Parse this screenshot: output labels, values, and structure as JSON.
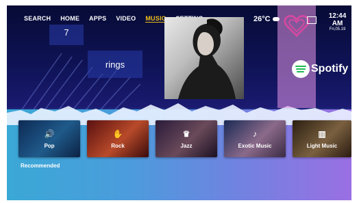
{
  "nav": {
    "items": [
      {
        "label": "SEARCH",
        "active": false
      },
      {
        "label": "HOME",
        "active": false
      },
      {
        "label": "APPS",
        "active": false
      },
      {
        "label": "VIDEO",
        "active": false
      },
      {
        "label": "MUSIC",
        "active": true
      },
      {
        "label": "SETTING",
        "active": false
      }
    ],
    "active_color": "#f2c21b"
  },
  "tiles": {
    "number": "7",
    "search_term": "rings"
  },
  "status": {
    "temperature": "26°C",
    "weather_icon": "cloud-icon",
    "time": "12:44 AM",
    "date": "Fri,05.19"
  },
  "spotify": {
    "label": "Spotify",
    "brand_color": "#1db954"
  },
  "categories": [
    {
      "label": "Pop",
      "icon": "music-icon"
    },
    {
      "label": "Rock",
      "icon": "rock-hand-icon"
    },
    {
      "label": "Jazz",
      "icon": "jazz-icon"
    },
    {
      "label": "Exotic Music",
      "icon": "note-icon"
    },
    {
      "label": "Light Music",
      "icon": "piano-icon"
    }
  ],
  "recommended_label": "Recommended"
}
